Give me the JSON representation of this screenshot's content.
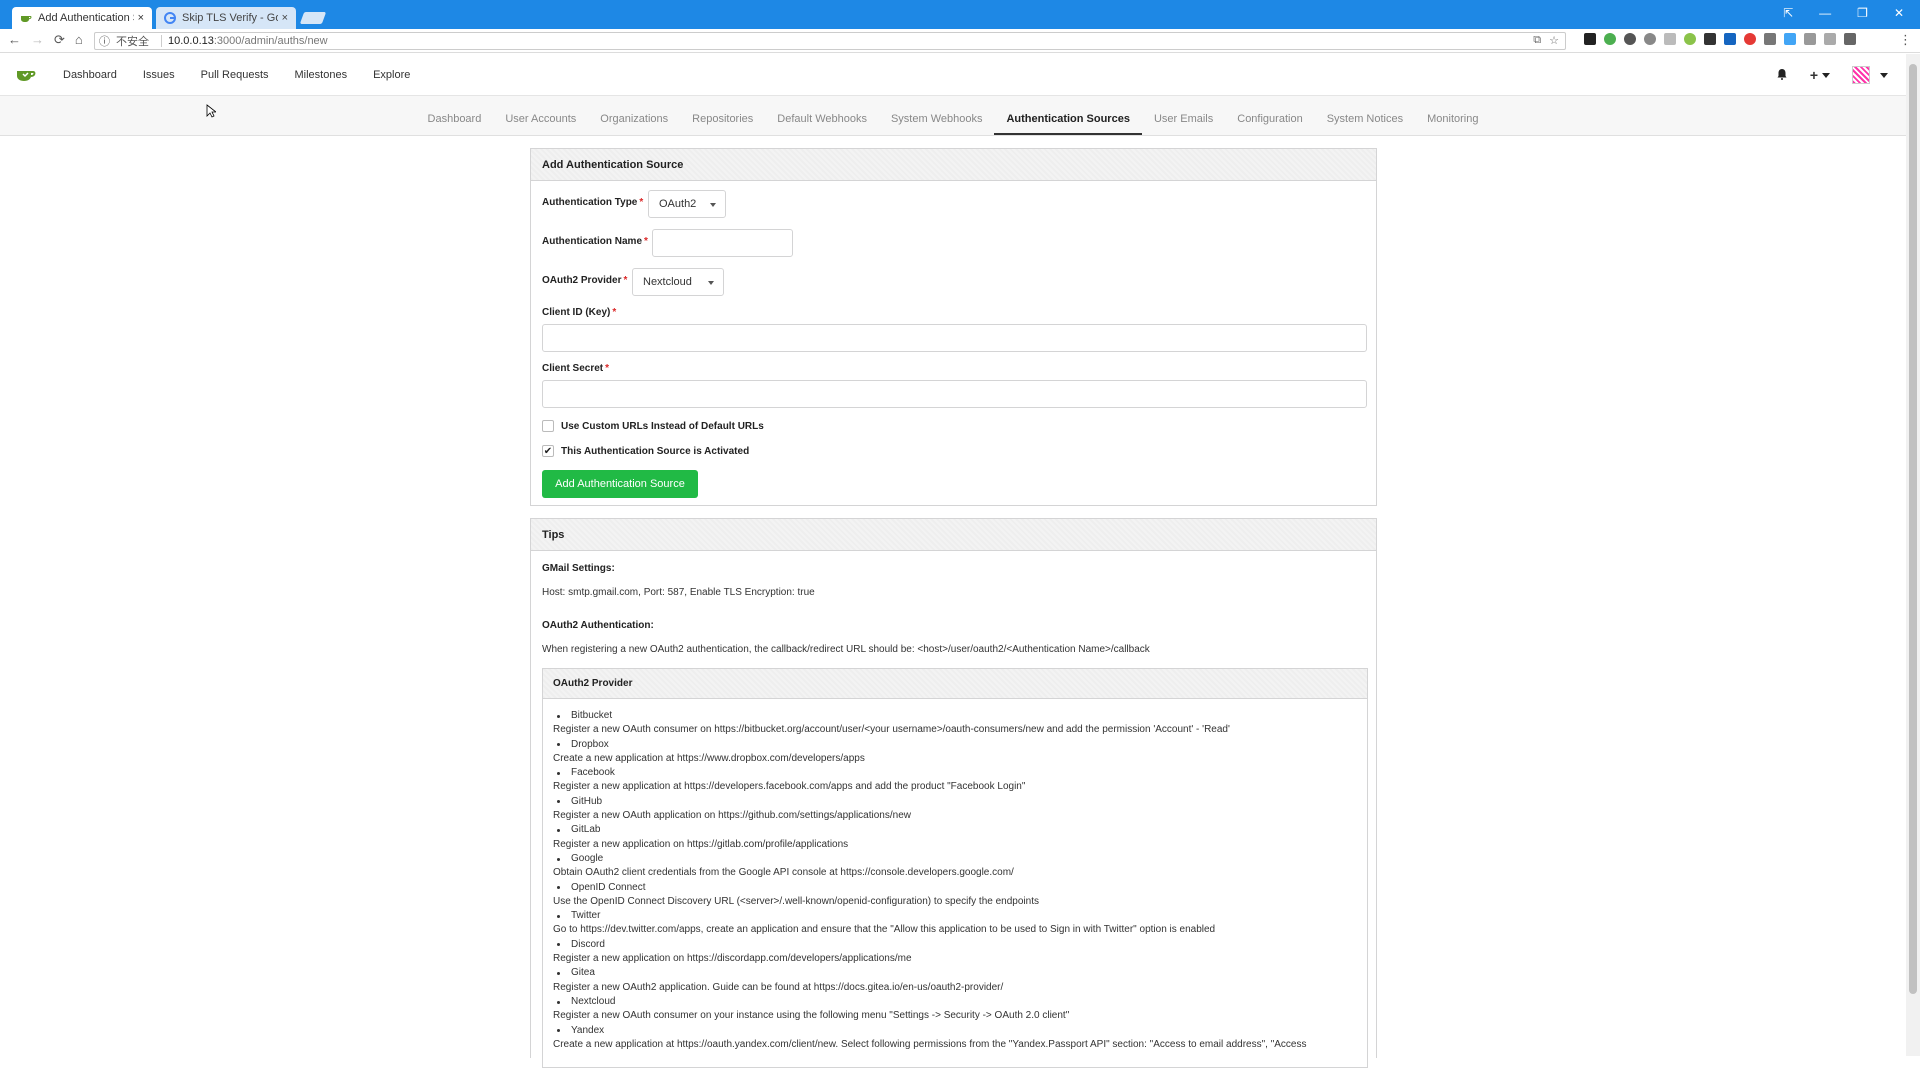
{
  "browser": {
    "tabs": [
      {
        "title": "Add Authentication So",
        "close": "×"
      },
      {
        "title": "Skip TLS Verify - Goog",
        "close": "×"
      }
    ],
    "window_controls": [
      "⇱",
      "—",
      "❐",
      "✕"
    ],
    "insecure_label": "不安全",
    "url_host": "10.0.0.13",
    "url_path": ":3000/admin/auths/new",
    "nav": {
      "back": "←",
      "forward": "→",
      "reload": "⟳",
      "home": "⌂"
    }
  },
  "topnav": {
    "links": [
      "Dashboard",
      "Issues",
      "Pull Requests",
      "Milestones",
      "Explore"
    ],
    "plus": "+"
  },
  "admin_tabs": [
    "Dashboard",
    "User Accounts",
    "Organizations",
    "Repositories",
    "Default Webhooks",
    "System Webhooks",
    "Authentication Sources",
    "User Emails",
    "Configuration",
    "System Notices",
    "Monitoring"
  ],
  "form": {
    "header": "Add Authentication Source",
    "auth_type_label": "Authentication Type",
    "auth_type_value": "OAuth2",
    "auth_name_label": "Authentication Name",
    "provider_label": "OAuth2 Provider",
    "provider_value": "Nextcloud",
    "client_id_label": "Client ID (Key)",
    "client_secret_label": "Client Secret",
    "custom_urls_label": "Use Custom URLs Instead of Default URLs",
    "activated_label": "This Authentication Source is Activated",
    "submit_label": "Add Authentication Source",
    "required_mark": "*",
    "check_mark": "✔"
  },
  "tips": {
    "header": "Tips",
    "gmail_title": "GMail Settings:",
    "gmail_text": "Host: smtp.gmail.com, Port: 587, Enable TLS Encryption: true",
    "oauth_title": "OAuth2 Authentication:",
    "oauth_text": "When registering a new OAuth2 authentication, the callback/redirect URL should be: <host>/user/oauth2/<Authentication Name>/callback",
    "provider_header": "OAuth2 Provider",
    "providers": [
      {
        "name": "Bitbucket",
        "desc": "Register a new OAuth consumer on https://bitbucket.org/account/user/<your username>/oauth-consumers/new and add the permission 'Account' - 'Read'"
      },
      {
        "name": "Dropbox",
        "desc": "Create a new application at https://www.dropbox.com/developers/apps"
      },
      {
        "name": "Facebook",
        "desc": "Register a new application at https://developers.facebook.com/apps and add the product \"Facebook Login\""
      },
      {
        "name": "GitHub",
        "desc": "Register a new OAuth application on https://github.com/settings/applications/new"
      },
      {
        "name": "GitLab",
        "desc": "Register a new application on https://gitlab.com/profile/applications"
      },
      {
        "name": "Google",
        "desc": "Obtain OAuth2 client credentials from the Google API console at https://console.developers.google.com/"
      },
      {
        "name": "OpenID Connect",
        "desc": "Use the OpenID Connect Discovery URL (<server>/.well-known/openid-configuration) to specify the endpoints"
      },
      {
        "name": "Twitter",
        "desc": "Go to https://dev.twitter.com/apps, create an application and ensure that the \"Allow this application to be used to Sign in with Twitter\" option is enabled"
      },
      {
        "name": "Discord",
        "desc": "Register a new application on https://discordapp.com/developers/applications/me"
      },
      {
        "name": "Gitea",
        "desc": "Register a new OAuth2 application. Guide can be found at https://docs.gitea.io/en-us/oauth2-provider/"
      },
      {
        "name": "Nextcloud",
        "desc": "Register a new OAuth consumer on your instance using the following menu \"Settings -> Security -> OAuth 2.0 client\""
      },
      {
        "name": "Yandex",
        "desc": "Create a new application at https://oauth.yandex.com/client/new. Select following permissions from the \"Yandex.Passport API\" section: \"Access to email address\", \"Access"
      }
    ]
  },
  "colors": {
    "chrome_blue": "#1e88e5",
    "gitea_green": "#609926",
    "submit_green": "#21ba45",
    "required_red": "#db2828"
  }
}
